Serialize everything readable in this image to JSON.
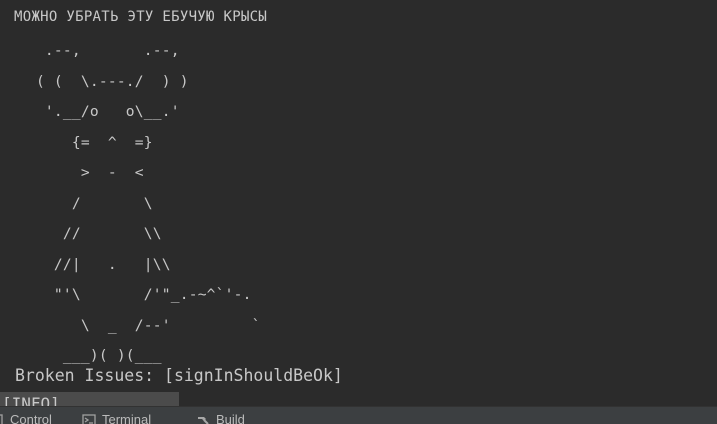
{
  "console": {
    "warning": "МОЖНО УБРАТЬ ЭТУ ЕБУЧУЮ КРЫСЫ",
    "ascii_art": [
      "     .--,       .--,",
      "    ( (  \\.---./  ) )",
      "     '.__/o   o\\__.'",
      "        {=  ^  =}",
      "         >  -  <",
      "        /       \\",
      "       //       \\\\",
      "      //|   .   |\\\\",
      "      \"'\\       /'\"_.-~^`'-.",
      "         \\  _  /--'         `",
      "       ___)( )(___"
    ],
    "broken_issues": "Broken Issues: [signInShouldBeOk]",
    "info": "[INFO]"
  },
  "toolbar": {
    "tabs": [
      {
        "label": "Control",
        "icon": "control-icon"
      },
      {
        "label": "Terminal",
        "icon": "terminal-icon"
      },
      {
        "label": "Build",
        "icon": "hammer-icon"
      }
    ]
  }
}
